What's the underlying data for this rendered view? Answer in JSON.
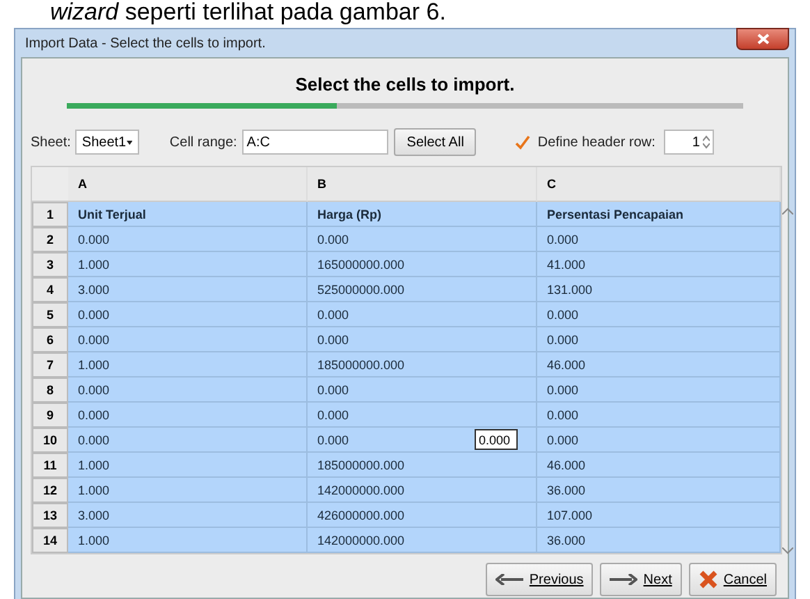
{
  "caption": "*wizard* seperti terlihat pada gambar 6.",
  "window": {
    "title": "Import Data - Select the cells to import."
  },
  "heading": "Select the cells to import.",
  "progress": {
    "level": 0.4
  },
  "sheet": {
    "label": "Sheet:",
    "value": "Sheet1"
  },
  "cell_range": {
    "label": "Cell range:",
    "value": "A:C"
  },
  "select_all": "Select All",
  "header_row": {
    "label": "Define header row:",
    "checked": true,
    "value": "1"
  },
  "table": {
    "columns": [
      "A",
      "B",
      "C"
    ],
    "rows": [
      {
        "number": "1",
        "header": true,
        "cells": [
          "Unit Terjual",
          "Harga (Rp)",
          "Persentasi Pencapaian"
        ]
      },
      {
        "number": "2",
        "header": false,
        "cells": [
          "0.000",
          "0.000",
          "0.000"
        ]
      },
      {
        "number": "3",
        "header": false,
        "cells": [
          "1.000",
          "165000000.000",
          "41.000"
        ]
      },
      {
        "number": "4",
        "header": false,
        "cells": [
          "3.000",
          "525000000.000",
          "131.000"
        ]
      },
      {
        "number": "5",
        "header": false,
        "cells": [
          "0.000",
          "0.000",
          "0.000"
        ]
      },
      {
        "number": "6",
        "header": false,
        "cells": [
          "0.000",
          "0.000",
          "0.000"
        ]
      },
      {
        "number": "7",
        "header": false,
        "cells": [
          "1.000",
          "185000000.000",
          "46.000"
        ]
      },
      {
        "number": "8",
        "header": false,
        "cells": [
          "0.000",
          "0.000",
          "0.000"
        ]
      },
      {
        "number": "9",
        "header": false,
        "cells": [
          "0.000",
          "0.000",
          "0.000"
        ]
      },
      {
        "number": "10",
        "header": false,
        "cells": [
          "0.000",
          "0.000",
          "0.000"
        ],
        "editor": "0.000"
      },
      {
        "number": "11",
        "header": false,
        "cells": [
          "1.000",
          "185000000.000",
          "46.000"
        ]
      },
      {
        "number": "12",
        "header": false,
        "cells": [
          "1.000",
          "142000000.000",
          "36.000"
        ]
      },
      {
        "number": "13",
        "header": false,
        "cells": [
          "3.000",
          "426000000.000",
          "107.000"
        ]
      },
      {
        "number": "14",
        "header": false,
        "cells": [
          "1.000",
          "142000000.000",
          "36.000"
        ]
      }
    ]
  },
  "buttons": [
    {
      "kind": "previous",
      "label": "Previous"
    },
    {
      "kind": "next",
      "label": "Next"
    },
    {
      "kind": "cancel",
      "label": "Cancel"
    }
  ]
}
